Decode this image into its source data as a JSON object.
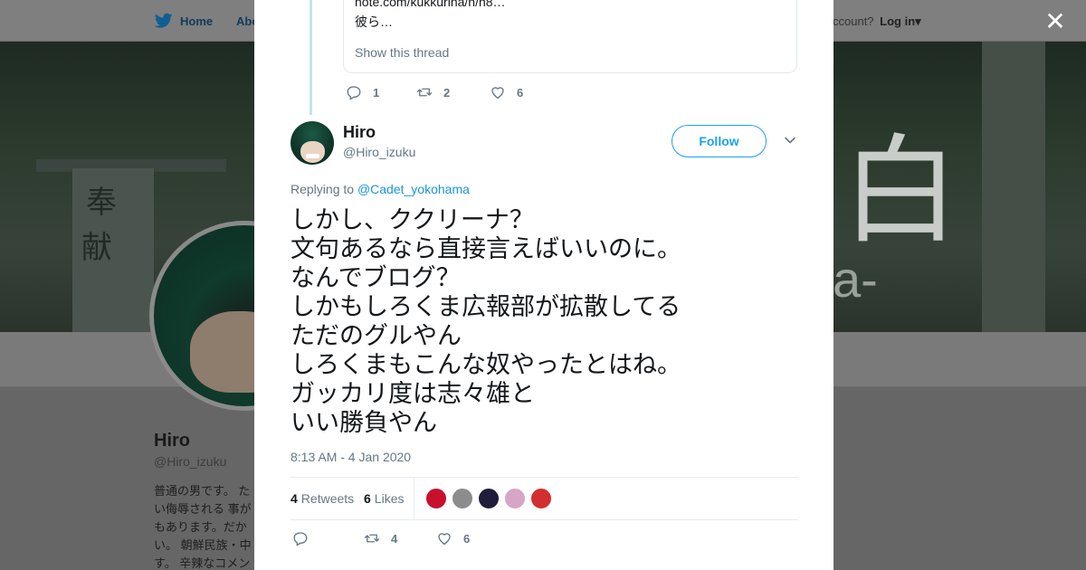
{
  "background": {
    "nav": {
      "home_label": "Home",
      "about_label": "Abo",
      "account_text": "ccount?",
      "login_label": "Log in▾"
    },
    "banner": {
      "kanji_top": "奉",
      "kanji_bottom": "献",
      "right_kanji": "白",
      "right_tagline": "a-"
    },
    "profile": {
      "name": "Hiro",
      "handle": "@Hiro_izuku",
      "bio": "普通の男です。 たい侮辱される 事がもあります。だかい。 朝鮮民族・中す。 辛辣なコメン"
    }
  },
  "close_icon_glyph": "✕",
  "quoted_tweet": {
    "line1": "note.com/kukkurina/n/n8…",
    "line2": "彼ら…",
    "show_thread": "Show this thread",
    "reply_count": "1",
    "retweet_count": "2",
    "like_count": "6"
  },
  "tweet": {
    "author_name": "Hiro",
    "author_handle": "@Hiro_izuku",
    "follow_label": "Follow",
    "replying_prefix": "Replying to ",
    "replying_mention": "@Cadet_yokohama",
    "lines": [
      "しかし、ククリーナ？",
      "文句あるなら直接言えばいいのに。",
      "なんでブログ？",
      "しかもしろくま広報部が拡散してる",
      "ただのグルやん",
      "しろくまもこんな奴やったとはね。",
      "ガッカリ度は志々雄と",
      "いい勝負やん"
    ],
    "timestamp": "8:13 AM - 4 Jan 2020",
    "retweets_count": "4",
    "retweets_label": "Retweets",
    "likes_count": "6",
    "likes_label": "Likes",
    "likers": [
      {
        "name": "liker-avatar-1",
        "color": "#c8102e"
      },
      {
        "name": "liker-avatar-2",
        "color": "#8c8c8c"
      },
      {
        "name": "liker-avatar-3",
        "color": "#1f1d3a"
      },
      {
        "name": "liker-avatar-4",
        "color": "#d7a6c6"
      },
      {
        "name": "liker-avatar-5",
        "color": "#d32f2f"
      }
    ],
    "action_retweet_count": "4",
    "action_like_count": "6"
  },
  "colors": {
    "accent": "#1da1f2",
    "link": "#1b95e0",
    "muted": "#657786",
    "text": "#14171a",
    "thread_line": "#c4e1f2"
  }
}
